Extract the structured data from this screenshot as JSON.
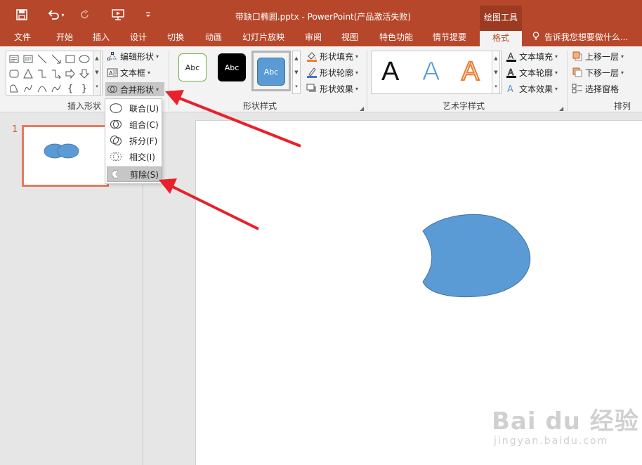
{
  "window": {
    "title": "带缺口椭圆.pptx - PowerPoint(产品激活失败)",
    "tool_header": "绘图工具"
  },
  "qat": {
    "save_icon": "save-icon",
    "undo_icon": "undo-icon",
    "redo_icon": "redo-icon",
    "present_icon": "presentation-icon"
  },
  "tabs": [
    {
      "label": "文件"
    },
    {
      "label": "开始"
    },
    {
      "label": "插入"
    },
    {
      "label": "设计"
    },
    {
      "label": "切换"
    },
    {
      "label": "动画"
    },
    {
      "label": "幻灯片放映"
    },
    {
      "label": "审阅"
    },
    {
      "label": "视图"
    },
    {
      "label": "特色功能"
    },
    {
      "label": "情节提要"
    },
    {
      "label": "格式"
    }
  ],
  "tellme": "告诉我您想要做什么...",
  "ribbon": {
    "insert_shapes": {
      "label": "插入形状",
      "edit_shape": "编辑形状",
      "text_box": "文本框",
      "merge_shapes": "合并形状"
    },
    "shape_styles": {
      "label": "形状样式",
      "samples": [
        "Abc",
        "Abc",
        "Abc"
      ],
      "fill": "形状填充",
      "outline": "形状轮廓",
      "effects": "形状效果"
    },
    "wordart": {
      "label": "艺术字样式",
      "letters": [
        "A",
        "A",
        "A"
      ],
      "text_fill": "文本填充",
      "text_outline": "文本轮廓",
      "text_effects": "文本效果"
    },
    "arrange": {
      "label": "排列",
      "bring_forward": "上移一层",
      "send_backward": "下移一层",
      "selection_pane": "选择窗格"
    }
  },
  "merge_menu": [
    {
      "label": "联合(U)"
    },
    {
      "label": "组合(C)"
    },
    {
      "label": "拆分(F)"
    },
    {
      "label": "相交(I)"
    },
    {
      "label": "剪除(S)"
    }
  ],
  "slides": [
    {
      "number": "1"
    }
  ],
  "colors": {
    "accent": "#b7472a",
    "shape_fill": "#5b9bd5",
    "shape_stroke": "#41719c",
    "arrow": "#e8212b"
  },
  "watermark": {
    "brand": "Bai du 经验",
    "url": "jingyan.baidu.com"
  }
}
